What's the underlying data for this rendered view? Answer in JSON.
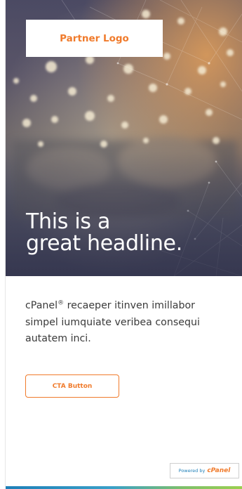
{
  "hero": {
    "logo_text": "Partner Logo",
    "headline_line1": "This is a",
    "headline_line2": "great headline."
  },
  "body": {
    "brand": "cPanel",
    "registered_mark": "®",
    "text": " recaeper itinven imillabor simpel iumquiate veribea consequi autatem inci."
  },
  "cta": {
    "label": "CTA Button"
  },
  "footer": {
    "powered_by": "Powered by",
    "brand": "cPanel"
  },
  "colors": {
    "accent": "#f07b2c",
    "link_blue": "#1e7fb8",
    "bottom_green": "#9bcf4f"
  }
}
